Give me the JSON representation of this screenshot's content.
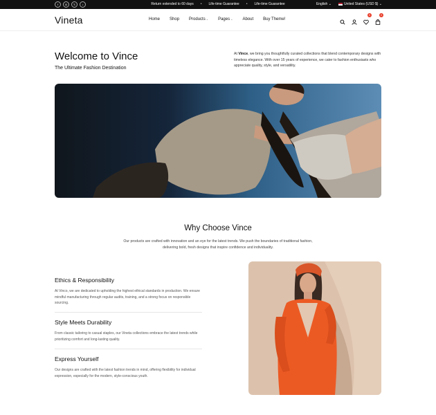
{
  "topbar": {
    "socials": [
      "f",
      "◎",
      "𝕏",
      "♪"
    ],
    "announcements": [
      "Return extended to 60 days",
      "Life-time Guarantee",
      "Life-time Guarantee"
    ],
    "separator": "•",
    "language": "English",
    "currency": "United States (USD $)",
    "caret": "⌄"
  },
  "header": {
    "logo": "Vineta",
    "nav": [
      {
        "label": "Home"
      },
      {
        "label": "Shop"
      },
      {
        "label": "Products",
        "caret": "⌄"
      },
      {
        "label": "Pages",
        "caret": "⌄"
      },
      {
        "label": "About"
      },
      {
        "label": "Buy Theme!"
      }
    ],
    "wishlist_count": "0",
    "cart_count": "0"
  },
  "hero": {
    "title": "Welcome to Vince",
    "subtitle": "The Ultimate Fashion Destination",
    "intro_prefix": "At ",
    "intro_brand": "Vince",
    "intro_rest": ", we bring you thoughtfully curated collections that blend contemporary designs with timeless elegance. With over 15 years of experience, we cater to fashion enthusiasts who appreciate quality, style, and versatility."
  },
  "why": {
    "title": "Why Choose Vince",
    "description": "Our products are crafted with innovation and an eye for the latest trends. We push the boundaries of traditional fashion, delivering bold, fresh designs that inspire confidence and individuality."
  },
  "features": [
    {
      "title": "Ethics & Responsibility",
      "text": "At Vinco, we are dedicated to upholding the highest ethical standards in production. We ensure mindful manufacturing through regular audits, training, and a strong focus on responsible sourcing."
    },
    {
      "title": "Style Meets Durability",
      "text": "From classic tailoring to casual staples, our Vineta collections embrace the latest trends while prioritizing comfort and long-lasting quality."
    },
    {
      "title": "Express Yourself",
      "text": "Our designs are crafted with the latest fashion trends in mind, offering flexibility for individual expression, especially for the modern, style-conscious youth."
    }
  ]
}
